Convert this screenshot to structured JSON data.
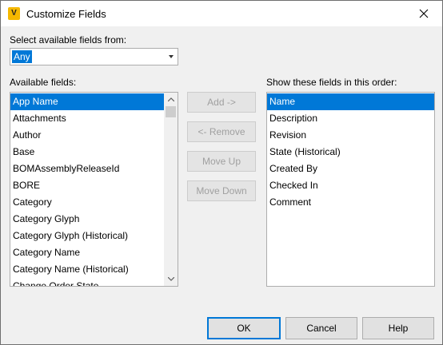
{
  "window": {
    "title": "Customize Fields"
  },
  "select_label": "Select available fields from:",
  "dropdown": {
    "value": "Any"
  },
  "available": {
    "label": "Available fields:",
    "items": [
      "App Name",
      "Attachments",
      "Author",
      "Base",
      "BOMAssemblyReleaseId",
      "BORE",
      "Category",
      "Category Glyph",
      "Category Glyph (Historical)",
      "Category Name",
      "Category Name (Historical)",
      "Change Order State"
    ],
    "selected_index": 0
  },
  "ordered": {
    "label": "Show these fields in this order:",
    "items": [
      "Name",
      "Description",
      "Revision",
      "State (Historical)",
      "Created By",
      "Checked In",
      "Comment"
    ],
    "selected_index": 0
  },
  "actions": {
    "add": "Add ->",
    "remove": "<- Remove",
    "move_up": "Move Up",
    "move_down": "Move Down"
  },
  "footer": {
    "ok": "OK",
    "cancel": "Cancel",
    "help": "Help"
  },
  "colors": {
    "accent": "#0078d7",
    "app_icon": "#f5b800"
  },
  "icons": {
    "app": "vault-app-icon",
    "close": "close-icon"
  }
}
